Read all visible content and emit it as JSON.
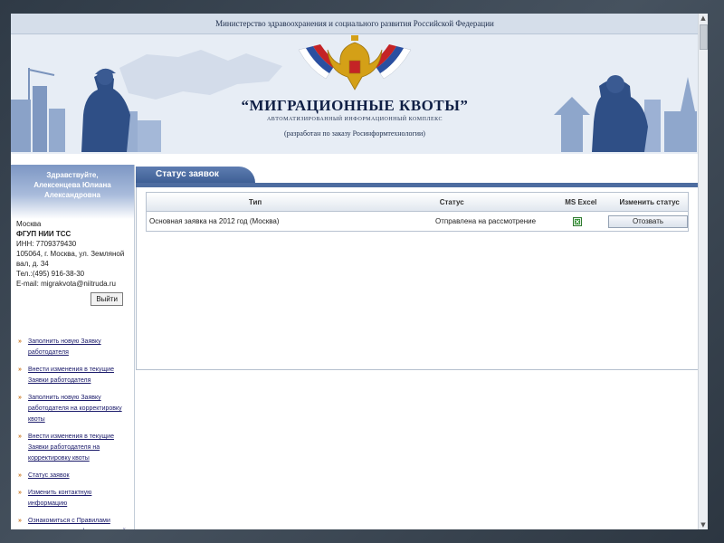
{
  "header": {
    "ministry": "Министерство здравоохранения и социального развития Российской Федерации",
    "title": "“МИГРАЦИОННЫЕ КВОТЫ”",
    "subtitle": "АВТОМАТИЗИРОВАННЫЙ ИНФОРМАЦИОННЫЙ КОМПЛЕКС",
    "note": "(разработан по заказу Росинформтехнологии)"
  },
  "sidebar": {
    "greeting": [
      "Здравствуйте,",
      "Алексенцева Юлиана",
      "Александровна"
    ],
    "org_lines": [
      "Москва",
      "ФГУП НИИ ТСС",
      "ИНН: 7709379430",
      "105064, г. Москва, ул. Земляной",
      "вал, д. 34",
      "Тел.:(495) 916-38-30",
      "E-mail: migrakvota@niitruda.ru"
    ],
    "logout_label": "Выйти",
    "menu": [
      "Заполнить новую Заявку работодателя",
      "Внести изменения в текущие Заявки работодателя",
      "Заполнить новую Заявку работодателя на корректировку квоты",
      "Внести изменения в текущие Заявки работодателя на корректировку квоты",
      "Статус заявок",
      "Изменить контактную информацию",
      "Ознакомиться с Правилами использования информационной"
    ]
  },
  "tab_label": "Статус заявок",
  "table": {
    "headers": [
      "Тип",
      "Статус",
      "MS Excel",
      "Изменить статус"
    ],
    "rows": [
      {
        "type": "Основная заявка на 2012 год (Москва)",
        "status": "Отправлена на рассмотрение",
        "excel_icon": "excel-icon",
        "action": "Отозвать"
      }
    ]
  },
  "colors": {
    "accent": "#4d6ca0",
    "greeting_bg": "#7d97c4",
    "link": "#1a1a6a",
    "arrow": "#c9741c"
  }
}
